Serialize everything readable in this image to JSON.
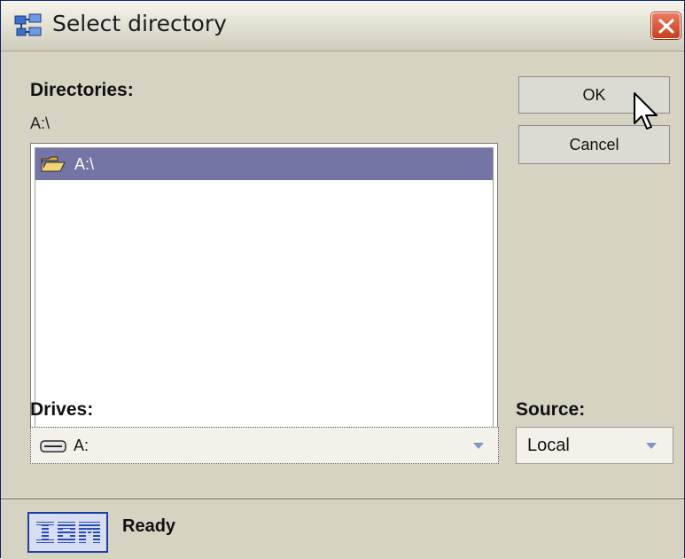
{
  "window": {
    "title": "Select directory",
    "icons": {
      "app": "directory-tree-icon",
      "close": "close-icon"
    },
    "colors": {
      "close_button": "#d4522f",
      "selection": "#7575a5",
      "logo_blue": "#1f3fa8"
    }
  },
  "directories": {
    "label": "Directories:",
    "current_path": "A:\\",
    "items": [
      {
        "label": "A:\\",
        "icon": "open-folder-icon",
        "selected": true
      }
    ]
  },
  "buttons": {
    "ok_label": "OK",
    "cancel_label": "Cancel"
  },
  "drives": {
    "label": "Drives:",
    "selected_value": "A:",
    "icon": "drive-icon"
  },
  "source": {
    "label": "Source:",
    "selected_value": "Local"
  },
  "status": {
    "logo": "IBM",
    "text": "Ready"
  }
}
